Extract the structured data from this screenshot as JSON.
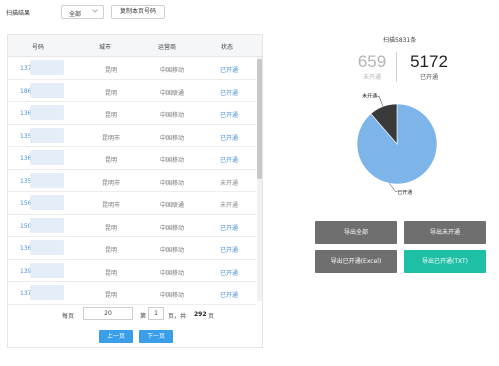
{
  "topbar": {
    "label": "扫描结果",
    "filter_value": "全部",
    "copy_button": "复制本页号码"
  },
  "table": {
    "headers": [
      "号码",
      "城市",
      "运营商",
      "状态"
    ],
    "rows": [
      {
        "phone": "137",
        "city": "昆明",
        "carrier": "中国移动",
        "status": "已开通"
      },
      {
        "phone": "186",
        "city": "昆明",
        "carrier": "中国联通",
        "status": "已开通"
      },
      {
        "phone": "136",
        "city": "昆明",
        "carrier": "中国移动",
        "status": "已开通"
      },
      {
        "phone": "135",
        "city": "昆明市",
        "carrier": "中国移动",
        "status": "已开通"
      },
      {
        "phone": "136",
        "city": "昆明",
        "carrier": "中国移动",
        "status": "已开通"
      },
      {
        "phone": "135",
        "city": "昆明市",
        "carrier": "中国移动",
        "status": "未开通"
      },
      {
        "phone": "156",
        "city": "昆明市",
        "carrier": "中国联通",
        "status": "未开通"
      },
      {
        "phone": "150",
        "city": "昆明",
        "carrier": "中国移动",
        "status": "已开通"
      },
      {
        "phone": "136",
        "city": "昆明",
        "carrier": "中国移动",
        "status": "已开通"
      },
      {
        "phone": "139",
        "city": "昆明",
        "carrier": "中国移动",
        "status": "已开通"
      },
      {
        "phone": "137",
        "city": "昆明",
        "carrier": "中国移动",
        "status": "已开通"
      }
    ]
  },
  "pager": {
    "per_page_label": "每页",
    "per_page_value": "20",
    "page_label_1": "第",
    "current_page": "1",
    "page_label_2": "页，共",
    "total_pages": "292",
    "page_label_3": "页",
    "prev": "上一页",
    "next": "下一页"
  },
  "summary": {
    "title": "扫描5831条",
    "not_open_count": "659",
    "not_open_label": "未开通",
    "open_count": "5172",
    "open_label": "已开通"
  },
  "chart_data": {
    "type": "pie",
    "slices": [
      {
        "label": "已开通",
        "value": 5172,
        "color": "#7db5ea"
      },
      {
        "label": "未开通",
        "value": 659,
        "color": "#3a3a3a"
      }
    ]
  },
  "actions": {
    "export_all": "导出全部",
    "export_not_open": "导出未开通",
    "export_open_excel": "导出已开通(Excel)",
    "export_open_txt": "导出已开通(TXT)"
  },
  "colors": {
    "link_blue": "#4a90d9",
    "button_blue": "#3a9ee8",
    "gray_button": "#6f6f6f",
    "teal_button": "#1fbfa5"
  }
}
